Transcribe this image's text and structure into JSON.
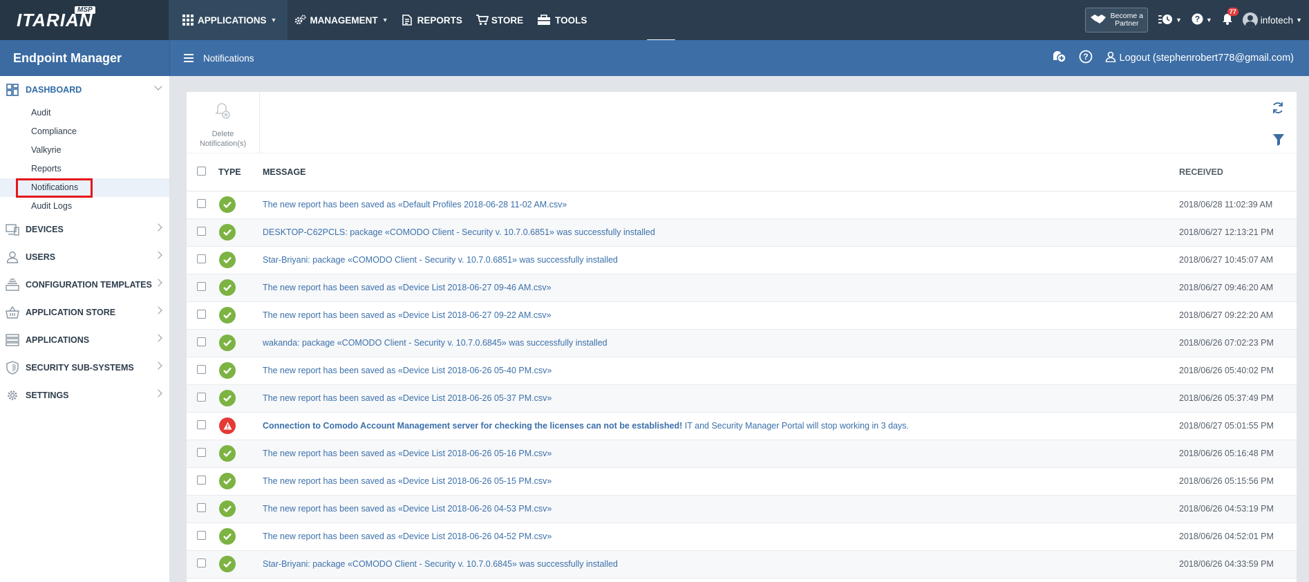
{
  "topbar": {
    "logo": "ITARIAN",
    "logo_badge": "MSP",
    "nav": [
      {
        "label": "APPLICATIONS",
        "has_caret": true
      },
      {
        "label": "MANAGEMENT",
        "has_caret": true
      },
      {
        "label": "REPORTS",
        "has_caret": false
      },
      {
        "label": "STORE",
        "has_caret": false
      },
      {
        "label": "TOOLS",
        "has_caret": false
      }
    ],
    "partner_line1": "Become a",
    "partner_line2": "Partner",
    "notification_count": "77",
    "user_name": "infotech"
  },
  "subbar": {
    "product_title": "Endpoint Manager",
    "breadcrumb": "Notifications",
    "logout_label": "Logout (stephenrobert778@gmail.com)"
  },
  "sidebar": {
    "dashboard": {
      "label": "DASHBOARD",
      "items": [
        "Audit",
        "Compliance",
        "Valkyrie",
        "Reports",
        "Notifications",
        "Audit Logs"
      ]
    },
    "sections": [
      {
        "label": "DEVICES",
        "icon": "devices-icon"
      },
      {
        "label": "USERS",
        "icon": "user-icon"
      },
      {
        "label": "CONFIGURATION TEMPLATES",
        "icon": "stack-icon"
      },
      {
        "label": "APPLICATION STORE",
        "icon": "basket-icon"
      },
      {
        "label": "APPLICATIONS",
        "icon": "server-icon"
      },
      {
        "label": "SECURITY SUB-SYSTEMS",
        "icon": "shield-icon"
      },
      {
        "label": "SETTINGS",
        "icon": "gear-icon"
      }
    ]
  },
  "toolbar": {
    "delete_label_1": "Delete",
    "delete_label_2": "Notification(s)"
  },
  "table": {
    "headers": {
      "type": "TYPE",
      "message": "MESSAGE",
      "received": "RECEIVED"
    },
    "rows": [
      {
        "type": "success",
        "message": "The new report has been saved as «Default Profiles 2018-06-28 11-02 AM.csv»",
        "received": "2018/06/28 11:02:39 AM"
      },
      {
        "type": "success",
        "message": "DESKTOP-C62PCLS: package «COMODO Client - Security v. 10.7.0.6851» was successfully installed",
        "received": "2018/06/27 12:13:21 PM"
      },
      {
        "type": "success",
        "message": "Star-Briyani: package «COMODO Client - Security v. 10.7.0.6851» was successfully installed",
        "received": "2018/06/27 10:45:07 AM"
      },
      {
        "type": "success",
        "message": "The new report has been saved as «Device List 2018-06-27 09-46 AM.csv»",
        "received": "2018/06/27 09:46:20 AM"
      },
      {
        "type": "success",
        "message": "The new report has been saved as «Device List 2018-06-27 09-22 AM.csv»",
        "received": "2018/06/27 09:22:20 AM"
      },
      {
        "type": "success",
        "message": "wakanda: package «COMODO Client - Security v. 10.7.0.6845» was successfully installed",
        "received": "2018/06/26 07:02:23 PM"
      },
      {
        "type": "success",
        "message": "The new report has been saved as «Device List 2018-06-26 05-40 PM.csv»",
        "received": "2018/06/26 05:40:02 PM"
      },
      {
        "type": "success",
        "message": "The new report has been saved as «Device List 2018-06-26 05-37 PM.csv»",
        "received": "2018/06/26 05:37:49 PM"
      },
      {
        "type": "error",
        "message_strong": "Connection to Comodo Account Management server for checking the licenses can not be established!",
        "message": " IT and Security Manager Portal will stop working in 3 days.",
        "received": "2018/06/27 05:01:55 PM"
      },
      {
        "type": "success",
        "message": "The new report has been saved as «Device List 2018-06-26 05-16 PM.csv»",
        "received": "2018/06/26 05:16:48 PM"
      },
      {
        "type": "success",
        "message": "The new report has been saved as «Device List 2018-06-26 05-15 PM.csv»",
        "received": "2018/06/26 05:15:56 PM"
      },
      {
        "type": "success",
        "message": "The new report has been saved as «Device List 2018-06-26 04-53 PM.csv»",
        "received": "2018/06/26 04:53:19 PM"
      },
      {
        "type": "success",
        "message": "The new report has been saved as «Device List 2018-06-26 04-52 PM.csv»",
        "received": "2018/06/26 04:52:01 PM"
      },
      {
        "type": "success",
        "message": "Star-Briyani: package «COMODO Client - Security v. 10.7.0.6845» was successfully installed",
        "received": "2018/06/26 04:33:59 PM"
      }
    ]
  },
  "colors": {
    "topbar": "#2b3d4f",
    "subbar": "#3d6ea6",
    "success": "#7cb342",
    "error": "#e53935",
    "link": "#3b70aa",
    "highlight": "#e3161d"
  }
}
